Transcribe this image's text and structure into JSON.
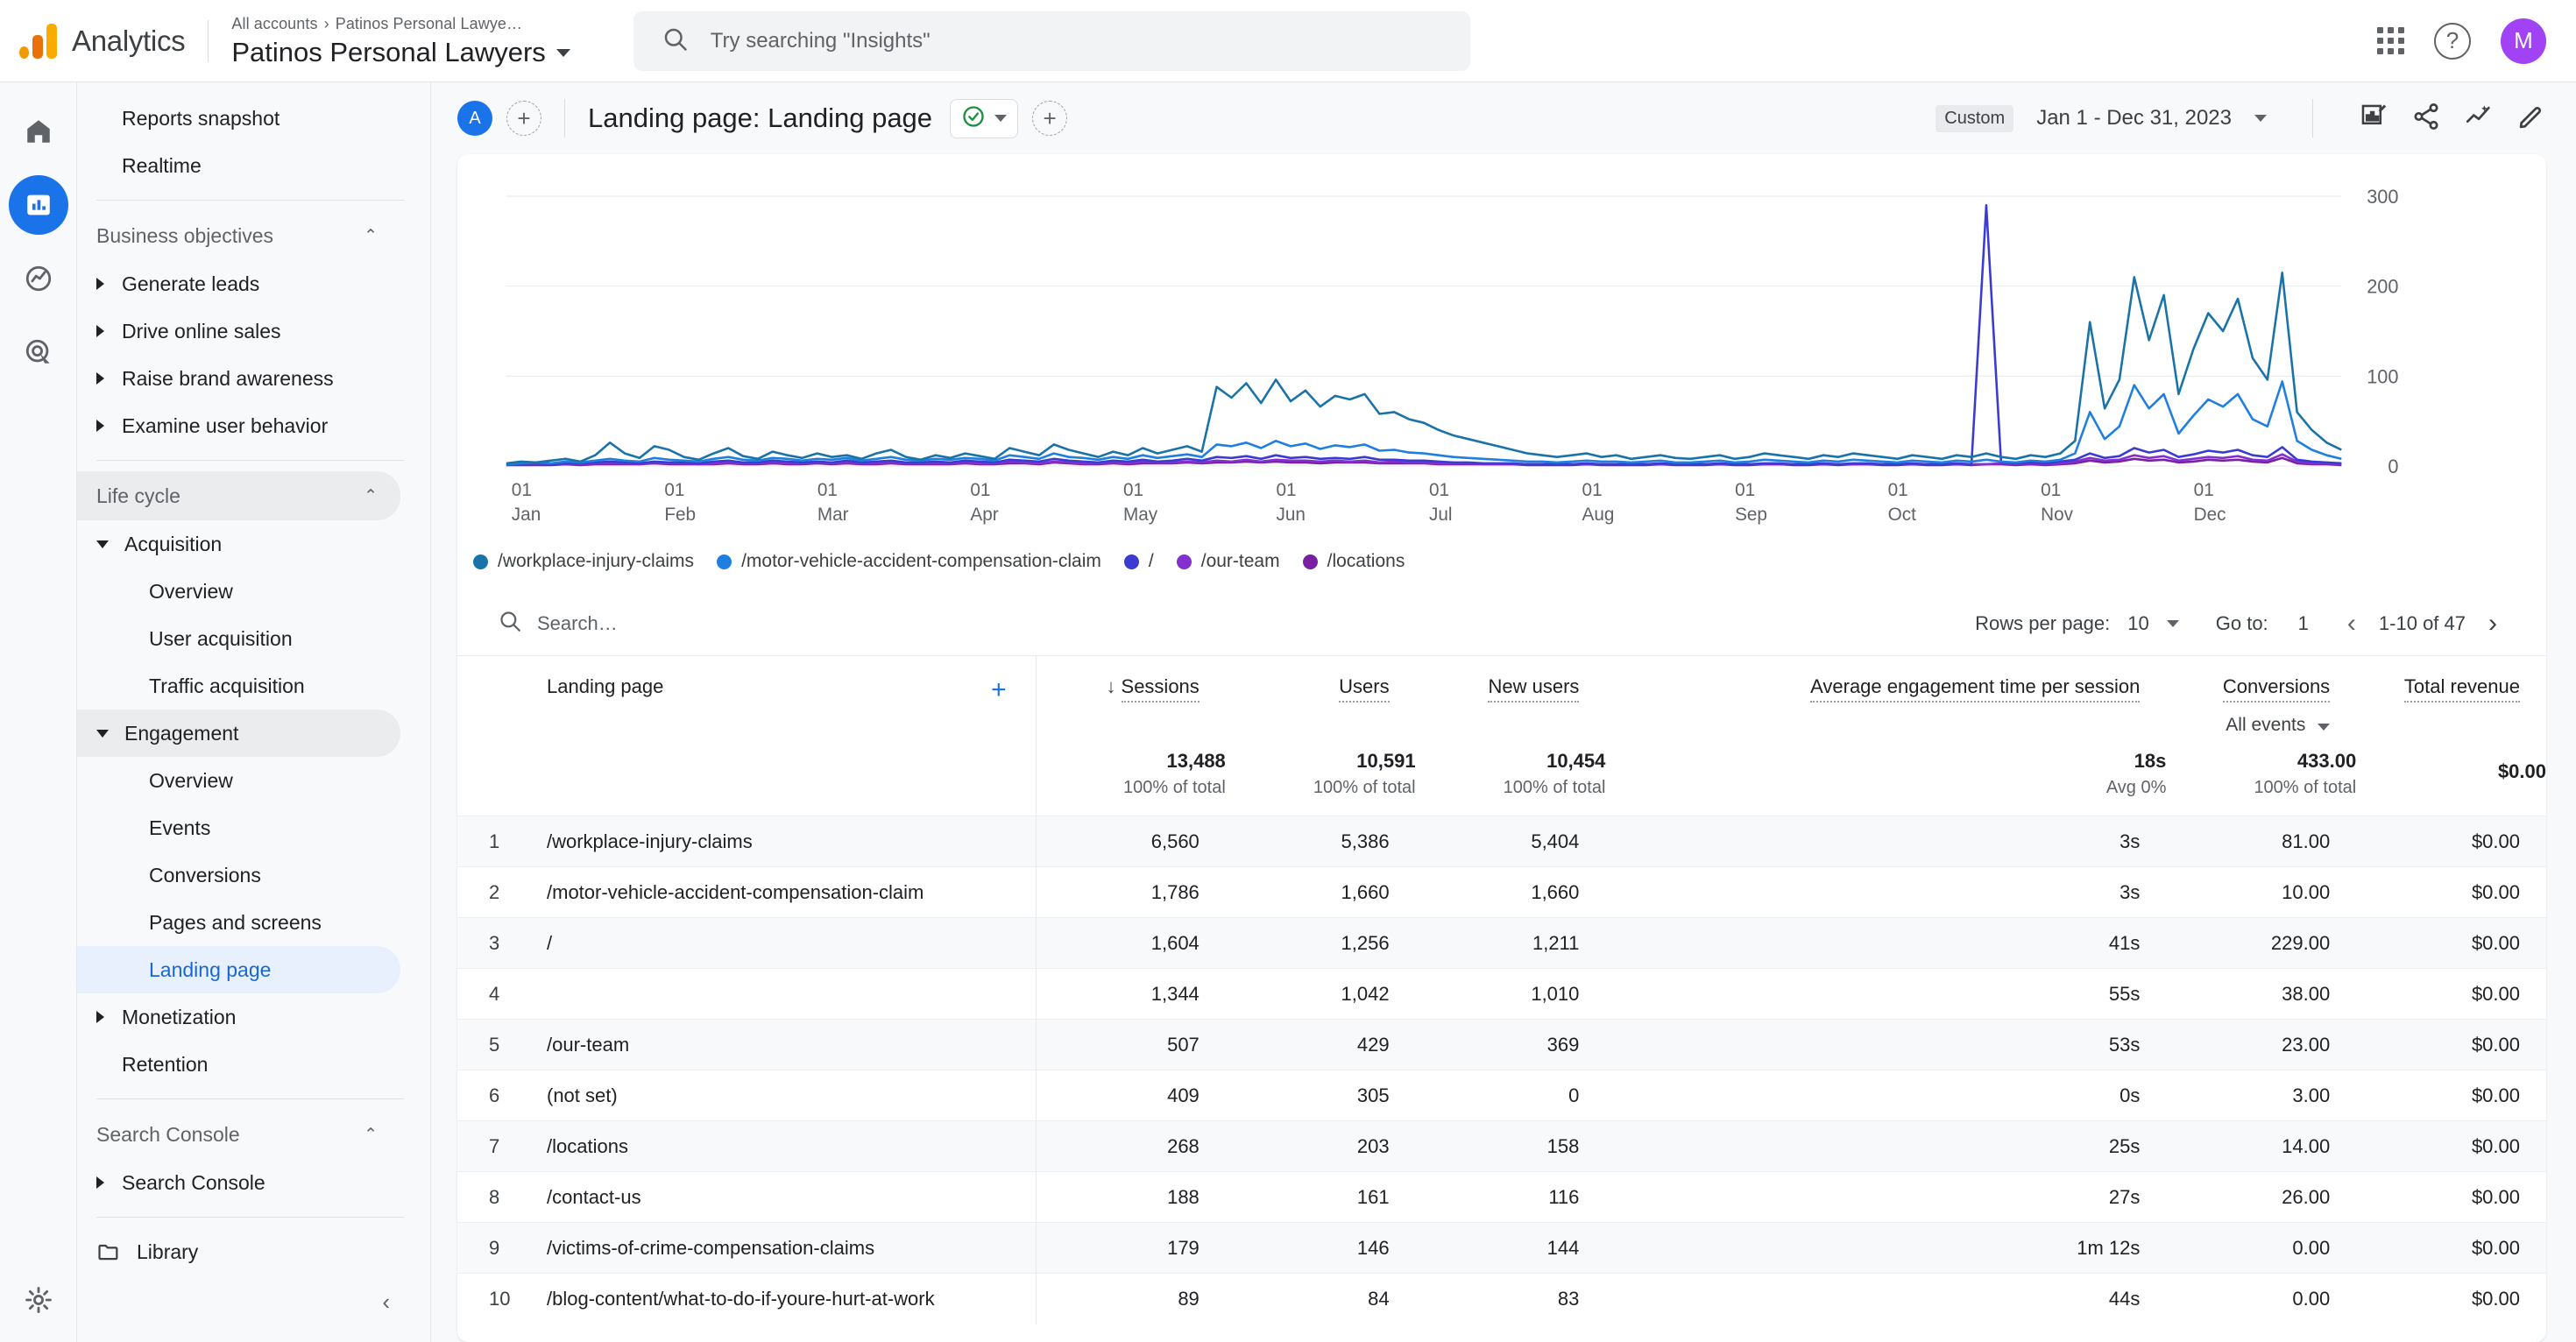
{
  "topbar": {
    "brand": "Analytics",
    "breadcrumb_root": "All accounts",
    "breadcrumb_sep": "›",
    "breadcrumb_child": "Patinos Personal Lawye…",
    "account_title": "Patinos Personal Lawyers",
    "search_placeholder": "Try searching \"Insights\"",
    "avatar_initial": "M",
    "help_glyph": "?",
    "icons": [
      "search-icon",
      "apps-grid-icon",
      "help-icon",
      "avatar"
    ]
  },
  "rail": {
    "items": [
      {
        "name": "home-icon",
        "label": "Home",
        "active": false
      },
      {
        "name": "reports-icon",
        "label": "Reports",
        "active": true
      },
      {
        "name": "explore-icon",
        "label": "Explore",
        "active": false
      },
      {
        "name": "advertising-icon",
        "label": "Advertising",
        "active": false
      }
    ],
    "settings_label": "Admin"
  },
  "nav": {
    "top_items": [
      {
        "label": "Reports snapshot"
      },
      {
        "label": "Realtime"
      }
    ],
    "sections": [
      {
        "header": "Business objectives",
        "collapsed_glyph": "⌃",
        "shaded": false,
        "items": [
          {
            "label": "Generate leads",
            "level": 1,
            "expander": "right"
          },
          {
            "label": "Drive online sales",
            "level": 1,
            "expander": "right"
          },
          {
            "label": "Raise brand awareness",
            "level": 1,
            "expander": "right"
          },
          {
            "label": "Examine user behavior",
            "level": 1,
            "expander": "right"
          }
        ]
      },
      {
        "header": "Life cycle",
        "collapsed_glyph": "⌃",
        "shaded": true,
        "items": [
          {
            "label": "Acquisition",
            "level": 1,
            "expander": "down"
          },
          {
            "label": "Overview",
            "level": 2
          },
          {
            "label": "User acquisition",
            "level": 2
          },
          {
            "label": "Traffic acquisition",
            "level": 2
          },
          {
            "label": "Engagement",
            "level": 1,
            "expander": "down",
            "shaded": true
          },
          {
            "label": "Overview",
            "level": 2
          },
          {
            "label": "Events",
            "level": 2
          },
          {
            "label": "Conversions",
            "level": 2
          },
          {
            "label": "Pages and screens",
            "level": 2
          },
          {
            "label": "Landing page",
            "level": 2,
            "selected": true
          },
          {
            "label": "Monetization",
            "level": 1,
            "expander": "right"
          },
          {
            "label": "Retention",
            "level": 1
          }
        ]
      },
      {
        "header": "Search Console",
        "collapsed_glyph": "⌃",
        "shaded": false,
        "items": [
          {
            "label": "Search Console",
            "level": 1,
            "expander": "right"
          }
        ]
      }
    ],
    "library": {
      "label": "Library",
      "icon": "folder-icon"
    },
    "collapse_glyph": "‹"
  },
  "report": {
    "comparison_badge": "A",
    "add_comparison_glyph": "+",
    "title": "Landing page: Landing page",
    "status_icon": "check-circle-icon",
    "add_glyph": "+",
    "date_tag": "Custom",
    "date_range": "Jan 1 - Dec 31, 2023",
    "actions": [
      "edit-comparison-icon",
      "share-icon",
      "insights-icon",
      "customize-pencil-icon"
    ]
  },
  "chart_data": {
    "type": "line",
    "title": "",
    "xlabel": "",
    "ylabel": "",
    "ylim": [
      0,
      300
    ],
    "yticks": [
      0,
      100,
      200,
      300
    ],
    "grid": true,
    "legend_position": "bottom",
    "tick_prefix": "01",
    "categories": [
      "Jan",
      "Feb",
      "Mar",
      "Apr",
      "May",
      "Jun",
      "Jul",
      "Aug",
      "Sep",
      "Oct",
      "Nov",
      "Dec"
    ],
    "series": [
      {
        "name": "/workplace-injury-claims",
        "color": "#1a73a8",
        "values": [
          3,
          5,
          4,
          6,
          8,
          5,
          12,
          26,
          14,
          9,
          22,
          18,
          10,
          7,
          14,
          20,
          11,
          8,
          16,
          12,
          9,
          14,
          10,
          12,
          8,
          14,
          18,
          10,
          7,
          12,
          9,
          14,
          11,
          8,
          20,
          16,
          12,
          24,
          18,
          14,
          10,
          16,
          12,
          20,
          14,
          18,
          22,
          16,
          88,
          76,
          92,
          70,
          96,
          72,
          84,
          66,
          78,
          74,
          80,
          58,
          60,
          52,
          48,
          40,
          34,
          30,
          26,
          22,
          18,
          14,
          12,
          10,
          12,
          14,
          10,
          12,
          8,
          10,
          12,
          9,
          8,
          10,
          12,
          8,
          10,
          14,
          12,
          10,
          8,
          12,
          10,
          14,
          12,
          10,
          8,
          12,
          10,
          8,
          12,
          10,
          14,
          10,
          8,
          12,
          10,
          14,
          28,
          160,
          64,
          96,
          210,
          140,
          190,
          80,
          130,
          170,
          150,
          186,
          120,
          96,
          215,
          60,
          40,
          26,
          18
        ]
      },
      {
        "name": "/motor-vehicle-accident-compensation-claim",
        "color": "#1f7fe0",
        "values": [
          2,
          3,
          4,
          3,
          5,
          4,
          6,
          8,
          6,
          5,
          9,
          7,
          6,
          5,
          8,
          10,
          7,
          6,
          9,
          8,
          6,
          8,
          7,
          9,
          6,
          8,
          10,
          7,
          6,
          8,
          7,
          9,
          8,
          6,
          12,
          10,
          8,
          14,
          10,
          9,
          7,
          10,
          8,
          12,
          9,
          11,
          13,
          10,
          24,
          22,
          26,
          20,
          28,
          22,
          25,
          19,
          23,
          21,
          24,
          17,
          18,
          15,
          14,
          12,
          10,
          9,
          8,
          7,
          6,
          5,
          5,
          4,
          5,
          6,
          5,
          5,
          4,
          5,
          6,
          4,
          4,
          5,
          6,
          4,
          5,
          7,
          6,
          5,
          4,
          6,
          5,
          7,
          6,
          5,
          4,
          6,
          5,
          4,
          6,
          5,
          7,
          5,
          4,
          6,
          5,
          7,
          14,
          60,
          30,
          44,
          90,
          64,
          80,
          36,
          56,
          74,
          66,
          80,
          52,
          44,
          94,
          28,
          18,
          12,
          8
        ]
      },
      {
        "name": "/",
        "color": "#3b3bd4",
        "values": [
          2,
          2,
          3,
          2,
          3,
          3,
          4,
          5,
          4,
          3,
          5,
          4,
          4,
          3,
          5,
          6,
          4,
          4,
          6,
          5,
          4,
          5,
          4,
          6,
          4,
          5,
          6,
          4,
          4,
          5,
          4,
          6,
          5,
          4,
          7,
          6,
          5,
          8,
          6,
          5,
          4,
          6,
          5,
          7,
          5,
          6,
          8,
          6,
          10,
          9,
          11,
          8,
          12,
          9,
          10,
          8,
          9,
          8,
          10,
          7,
          7,
          6,
          6,
          5,
          4,
          4,
          3,
          3,
          3,
          2,
          2,
          2,
          2,
          3,
          2,
          2,
          2,
          2,
          3,
          2,
          2,
          2,
          3,
          2,
          2,
          3,
          3,
          2,
          2,
          3,
          2,
          3,
          3,
          2,
          2,
          3,
          2,
          2,
          3,
          2,
          290,
          4,
          3,
          4,
          3,
          5,
          7,
          14,
          9,
          11,
          20,
          15,
          18,
          10,
          13,
          17,
          15,
          18,
          12,
          10,
          21,
          7,
          5,
          4,
          3
        ]
      },
      {
        "name": "/our-team",
        "color": "#8430ce",
        "values": [
          1,
          2,
          2,
          2,
          2,
          2,
          3,
          3,
          3,
          2,
          4,
          3,
          3,
          2,
          3,
          4,
          3,
          3,
          4,
          3,
          3,
          4,
          3,
          4,
          3,
          3,
          4,
          3,
          3,
          3,
          3,
          4,
          3,
          3,
          5,
          4,
          3,
          5,
          4,
          3,
          3,
          4,
          3,
          5,
          4,
          4,
          5,
          4,
          6,
          5,
          7,
          5,
          7,
          6,
          6,
          5,
          6,
          5,
          6,
          4,
          5,
          4,
          4,
          3,
          3,
          3,
          2,
          2,
          2,
          2,
          2,
          2,
          2,
          2,
          2,
          2,
          2,
          2,
          2,
          2,
          2,
          2,
          2,
          2,
          2,
          2,
          2,
          2,
          2,
          2,
          2,
          2,
          2,
          2,
          2,
          2,
          2,
          2,
          2,
          2,
          2,
          3,
          2,
          3,
          2,
          3,
          5,
          9,
          6,
          7,
          12,
          9,
          11,
          6,
          8,
          10,
          9,
          11,
          7,
          6,
          13,
          5,
          3,
          3,
          2
        ]
      },
      {
        "name": "/locations",
        "color": "#7b1fa2",
        "values": [
          1,
          1,
          1,
          1,
          2,
          1,
          2,
          2,
          2,
          2,
          3,
          2,
          2,
          2,
          2,
          3,
          2,
          2,
          3,
          2,
          2,
          3,
          2,
          3,
          2,
          2,
          3,
          2,
          2,
          2,
          2,
          3,
          2,
          2,
          3,
          3,
          2,
          4,
          3,
          2,
          2,
          3,
          2,
          3,
          3,
          3,
          4,
          3,
          4,
          4,
          5,
          4,
          5,
          4,
          4,
          3,
          4,
          4,
          4,
          3,
          3,
          3,
          3,
          2,
          2,
          2,
          2,
          2,
          2,
          1,
          1,
          1,
          1,
          2,
          1,
          1,
          1,
          1,
          2,
          1,
          1,
          1,
          2,
          1,
          1,
          2,
          2,
          1,
          1,
          2,
          1,
          2,
          2,
          1,
          1,
          2,
          1,
          1,
          2,
          1,
          2,
          2,
          1,
          2,
          1,
          2,
          3,
          6,
          4,
          5,
          8,
          6,
          7,
          4,
          5,
          7,
          6,
          7,
          5,
          4,
          9,
          3,
          2,
          2,
          1
        ]
      }
    ]
  },
  "table": {
    "search_placeholder": "Search…",
    "rows_per_page_label": "Rows per page:",
    "rows_per_page_value": "10",
    "goto_label": "Go to:",
    "goto_value": "1",
    "range_label": "1-10 of 47",
    "prev_glyph": "‹",
    "next_glyph": "›",
    "dimension_header": "Landing page",
    "add_dimension_glyph": "+",
    "sort_glyph": "↓",
    "columns": [
      {
        "label": "Sessions",
        "sorted": true
      },
      {
        "label": "Users",
        "sorted": false
      },
      {
        "label": "New users",
        "sorted": false
      },
      {
        "label": "Average engagement time per session",
        "sorted": false
      },
      {
        "label": "Conversions",
        "sorted": false,
        "sub": "All events"
      },
      {
        "label": "Total revenue",
        "sorted": false
      }
    ],
    "totals": {
      "sessions": "13,488",
      "sessions_sub": "100% of total",
      "users": "10,591",
      "users_sub": "100% of total",
      "new_users": "10,454",
      "new_users_sub": "100% of total",
      "avg_time": "18s",
      "avg_time_sub": "Avg 0%",
      "conversions": "433.00",
      "conversions_sub": "100% of total",
      "revenue": "$0.00",
      "revenue_sub": ""
    },
    "rows": [
      {
        "idx": "1",
        "page": "/workplace-injury-claims",
        "sessions": "6,560",
        "users": "5,386",
        "new_users": "5,404",
        "avg_time": "3s",
        "conversions": "81.00",
        "revenue": "$0.00"
      },
      {
        "idx": "2",
        "page": "/motor-vehicle-accident-compensation-claim",
        "sessions": "1,786",
        "users": "1,660",
        "new_users": "1,660",
        "avg_time": "3s",
        "conversions": "10.00",
        "revenue": "$0.00"
      },
      {
        "idx": "3",
        "page": "/",
        "sessions": "1,604",
        "users": "1,256",
        "new_users": "1,211",
        "avg_time": "41s",
        "conversions": "229.00",
        "revenue": "$0.00"
      },
      {
        "idx": "4",
        "page": "",
        "sessions": "1,344",
        "users": "1,042",
        "new_users": "1,010",
        "avg_time": "55s",
        "conversions": "38.00",
        "revenue": "$0.00"
      },
      {
        "idx": "5",
        "page": "/our-team",
        "sessions": "507",
        "users": "429",
        "new_users": "369",
        "avg_time": "53s",
        "conversions": "23.00",
        "revenue": "$0.00"
      },
      {
        "idx": "6",
        "page": "(not set)",
        "sessions": "409",
        "users": "305",
        "new_users": "0",
        "avg_time": "0s",
        "conversions": "3.00",
        "revenue": "$0.00"
      },
      {
        "idx": "7",
        "page": "/locations",
        "sessions": "268",
        "users": "203",
        "new_users": "158",
        "avg_time": "25s",
        "conversions": "14.00",
        "revenue": "$0.00"
      },
      {
        "idx": "8",
        "page": "/contact-us",
        "sessions": "188",
        "users": "161",
        "new_users": "116",
        "avg_time": "27s",
        "conversions": "26.00",
        "revenue": "$0.00"
      },
      {
        "idx": "9",
        "page": "/victims-of-crime-compensation-claims",
        "sessions": "179",
        "users": "146",
        "new_users": "144",
        "avg_time": "1m 12s",
        "conversions": "0.00",
        "revenue": "$0.00"
      },
      {
        "idx": "10",
        "page": "/blog-content/what-to-do-if-youre-hurt-at-work",
        "sessions": "89",
        "users": "84",
        "new_users": "83",
        "avg_time": "44s",
        "conversions": "0.00",
        "revenue": "$0.00"
      }
    ]
  }
}
